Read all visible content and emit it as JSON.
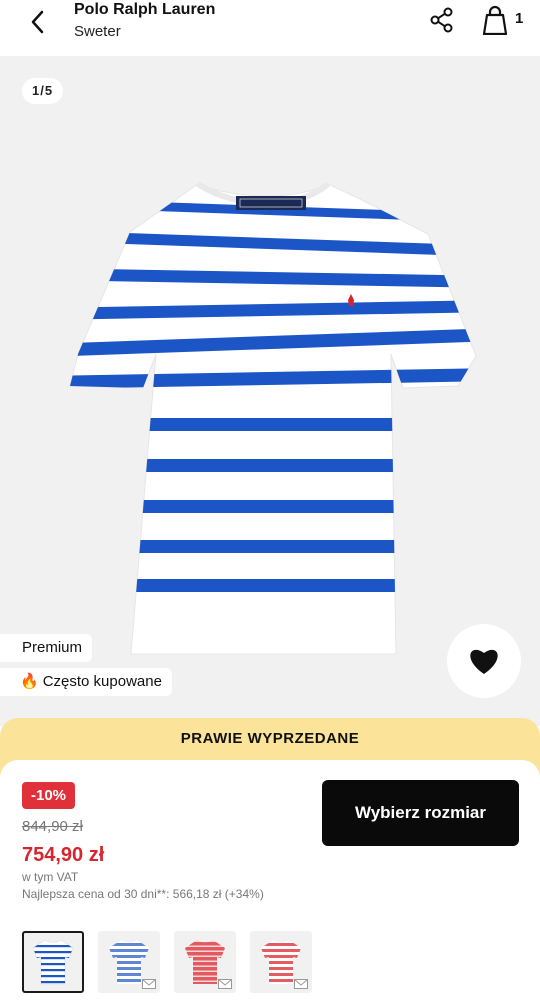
{
  "header": {
    "brand": "Polo Ralph Lauren",
    "subtitle": "Sweter",
    "cart_count": "1",
    "icons": [
      "back-arrow-icon",
      "share-icon",
      "shopping-bag-icon"
    ]
  },
  "gallery": {
    "counter": "1/5",
    "badges": [
      "Premium",
      "Często kupowane"
    ],
    "popular_icon": "fire-icon",
    "shirt_colors": {
      "base": "#ffffff",
      "stripe": "#1b55c6",
      "logo": "#d22630"
    }
  },
  "sale_bar": {
    "text": "PRAWIE WYPRZEDANE",
    "color": "#fbe39a"
  },
  "pricing": {
    "discount": "-10%",
    "old_price": "844,90 zł",
    "new_price": "754,90 zł",
    "vat": "w tym VAT",
    "best_price": "Najlepsza cena od 30 dni**: 566,18 zł (+34%)"
  },
  "actions": {
    "choose_size": "Wybierz rozmiar"
  },
  "thumbnails": [
    {
      "name": "white-blue-stripes",
      "stripe": "#1b55c6",
      "base": "#ffffff",
      "selected": true
    },
    {
      "name": "blue-white-stripes",
      "stripe": "#5f86d6",
      "base": "#ffffff",
      "selected": false
    },
    {
      "name": "red-white-stripes",
      "stripe": "#e05a5f",
      "base": "#f7d7d8",
      "selected": false
    },
    {
      "name": "red-white-stripes-2",
      "stripe": "#e55b60",
      "base": "#ffffff",
      "selected": false
    }
  ]
}
